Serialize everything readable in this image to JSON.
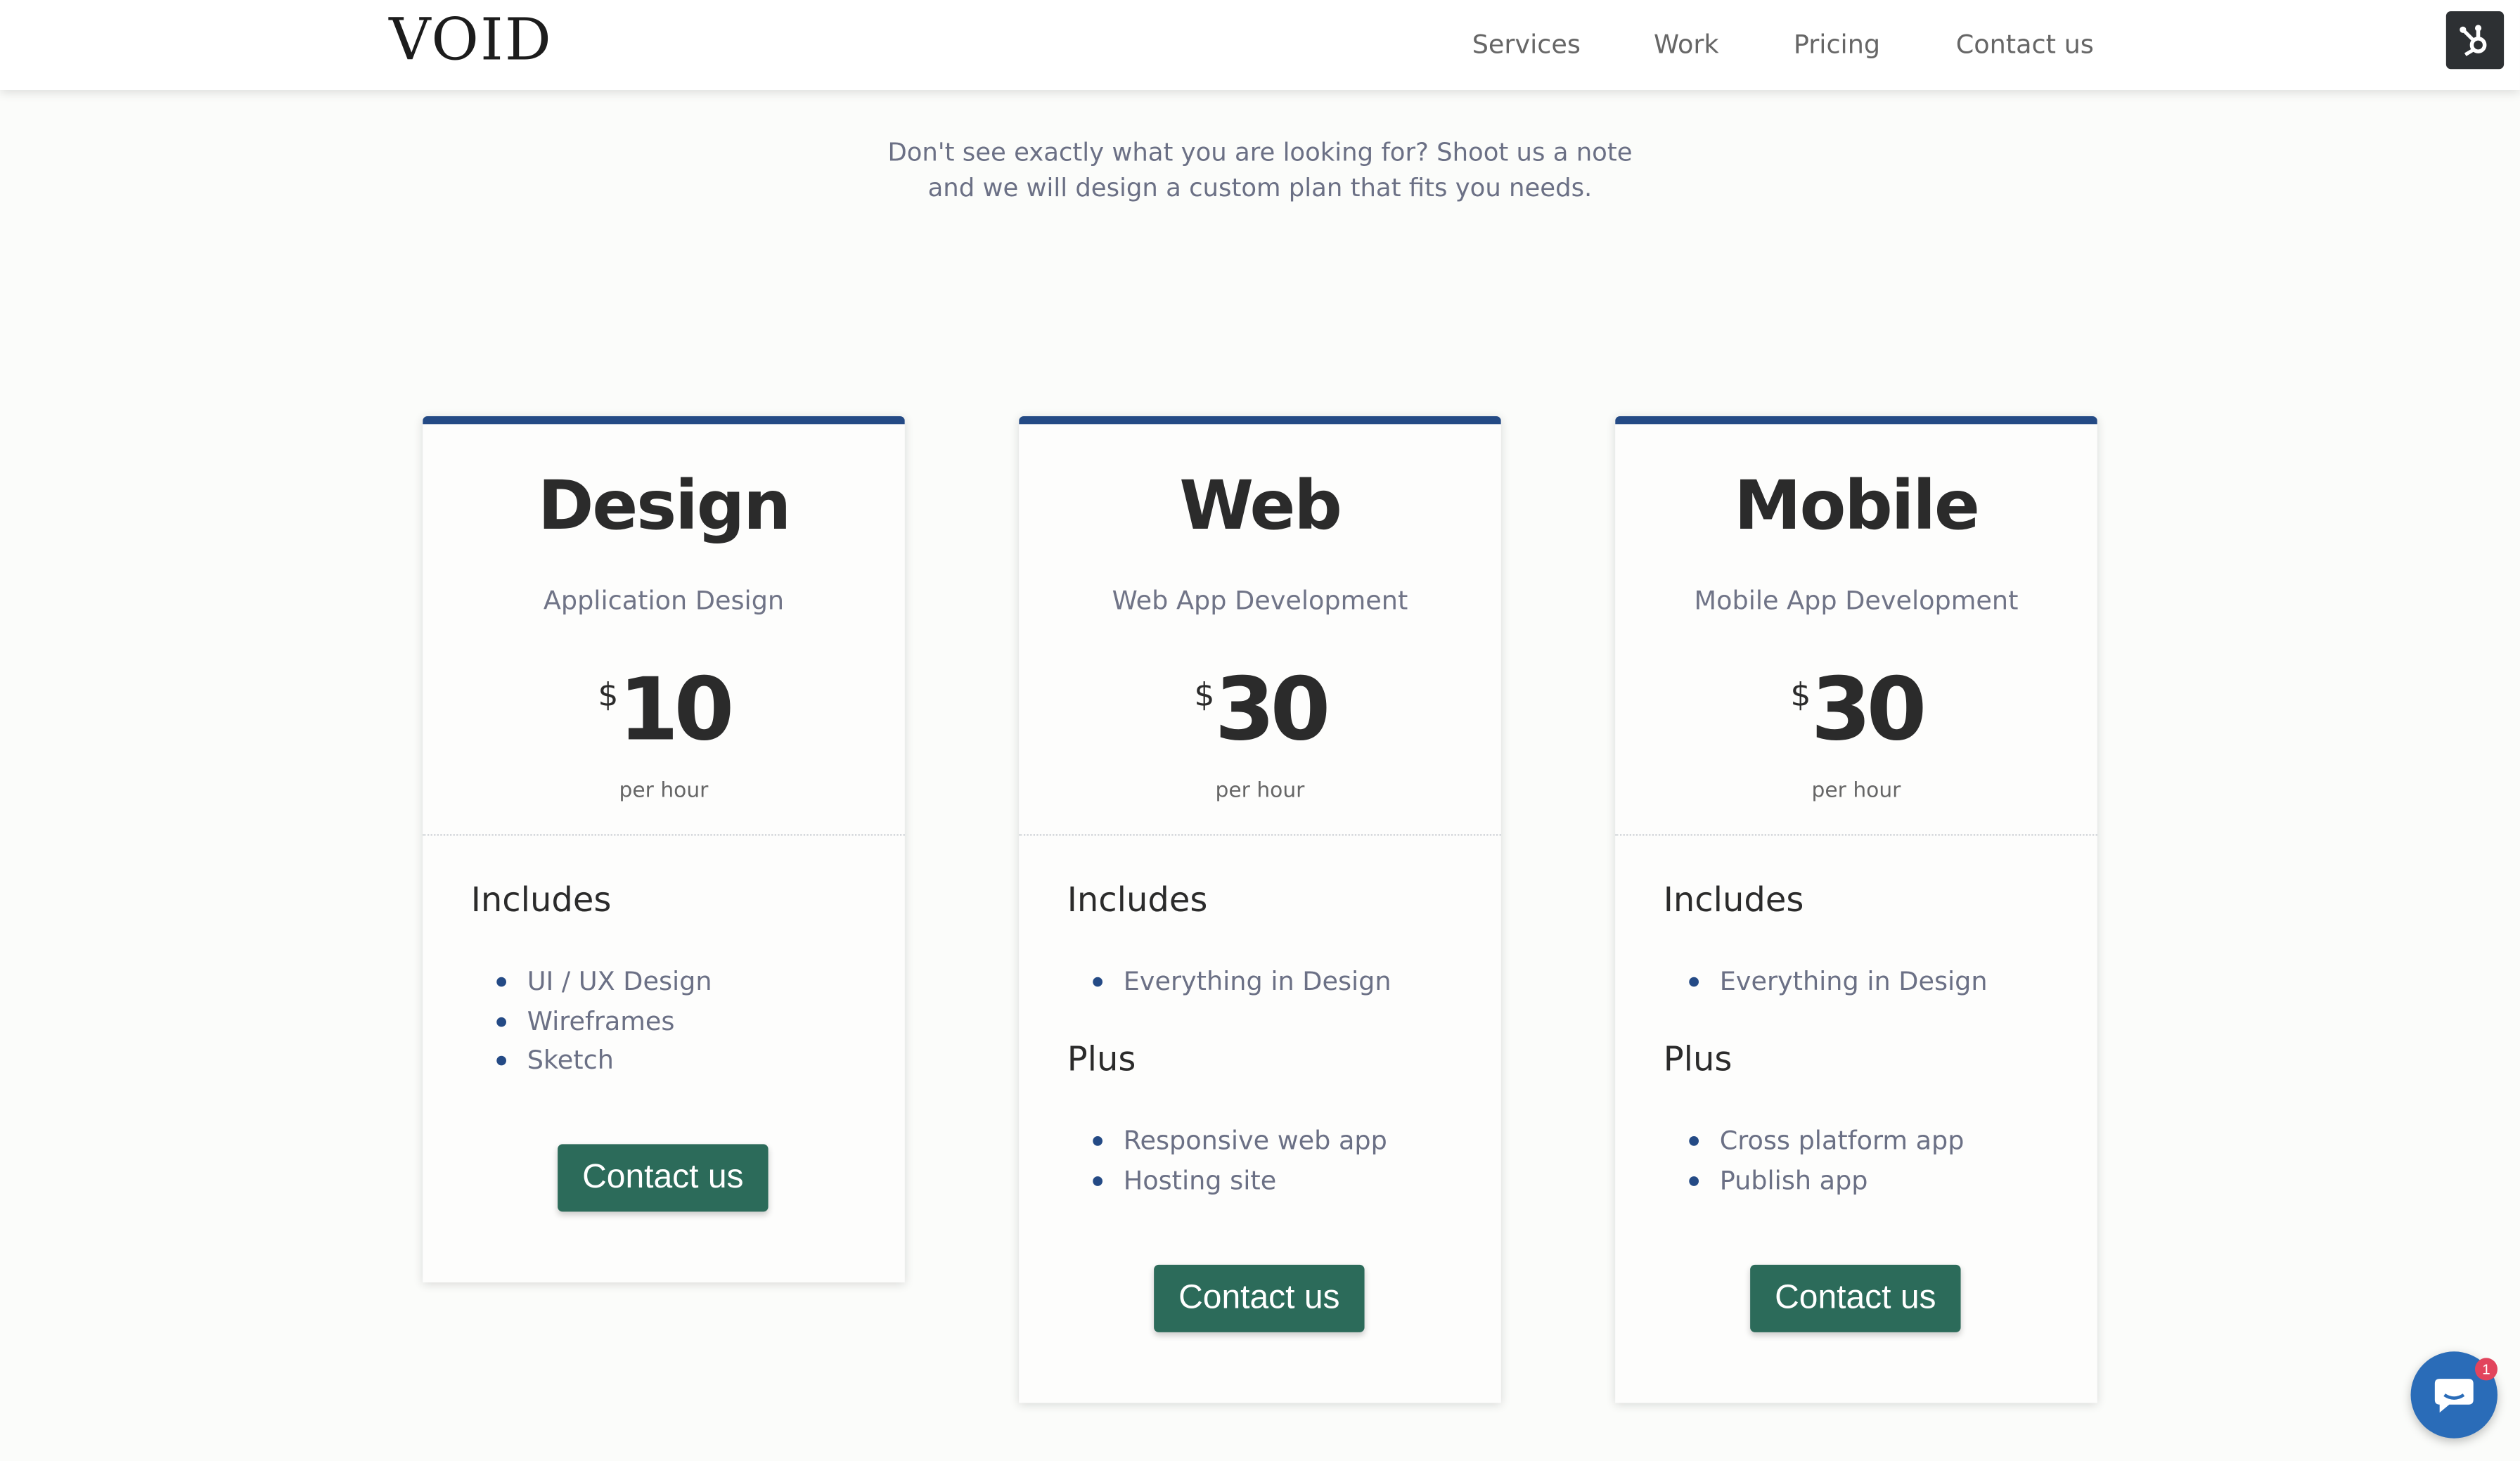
{
  "header": {
    "logo": "VOID",
    "nav": [
      "Services",
      "Work",
      "Pricing",
      "Contact us"
    ]
  },
  "intro": {
    "line1": "Don't see exactly what you are looking for? Shoot us a note",
    "line2": "and we will design a custom plan that fits you needs."
  },
  "cards": [
    {
      "title": "Design",
      "subtitle": "Application Design",
      "currency": "$",
      "price": "10",
      "period": "per hour",
      "includes_label": "Includes",
      "includes": [
        "UI / UX Design",
        "Wireframes",
        "Sketch"
      ],
      "button": "Contact us"
    },
    {
      "title": "Web",
      "subtitle": "Web App Development",
      "currency": "$",
      "price": "30",
      "period": "per hour",
      "includes_label": "Includes",
      "includes": [
        "Everything in Design"
      ],
      "plus_label": "Plus",
      "plus": [
        "Responsive web app",
        "Hosting site"
      ],
      "button": "Contact us"
    },
    {
      "title": "Mobile",
      "subtitle": "Mobile App Development",
      "currency": "$",
      "price": "30",
      "period": "per hour",
      "includes_label": "Includes",
      "includes": [
        "Everything in Design"
      ],
      "plus_label": "Plus",
      "plus": [
        "Cross platform app",
        "Publish app"
      ],
      "button": "Contact us"
    }
  ],
  "chat": {
    "badge_count": "1",
    "icon": "chat-bubble-icon"
  },
  "hub_icon": "hubspot-sprocket-icon",
  "colors": {
    "accent_border": "#244a85",
    "button": "#2c6b5a",
    "chat": "#2a6cb8",
    "badge": "#e2445c"
  }
}
